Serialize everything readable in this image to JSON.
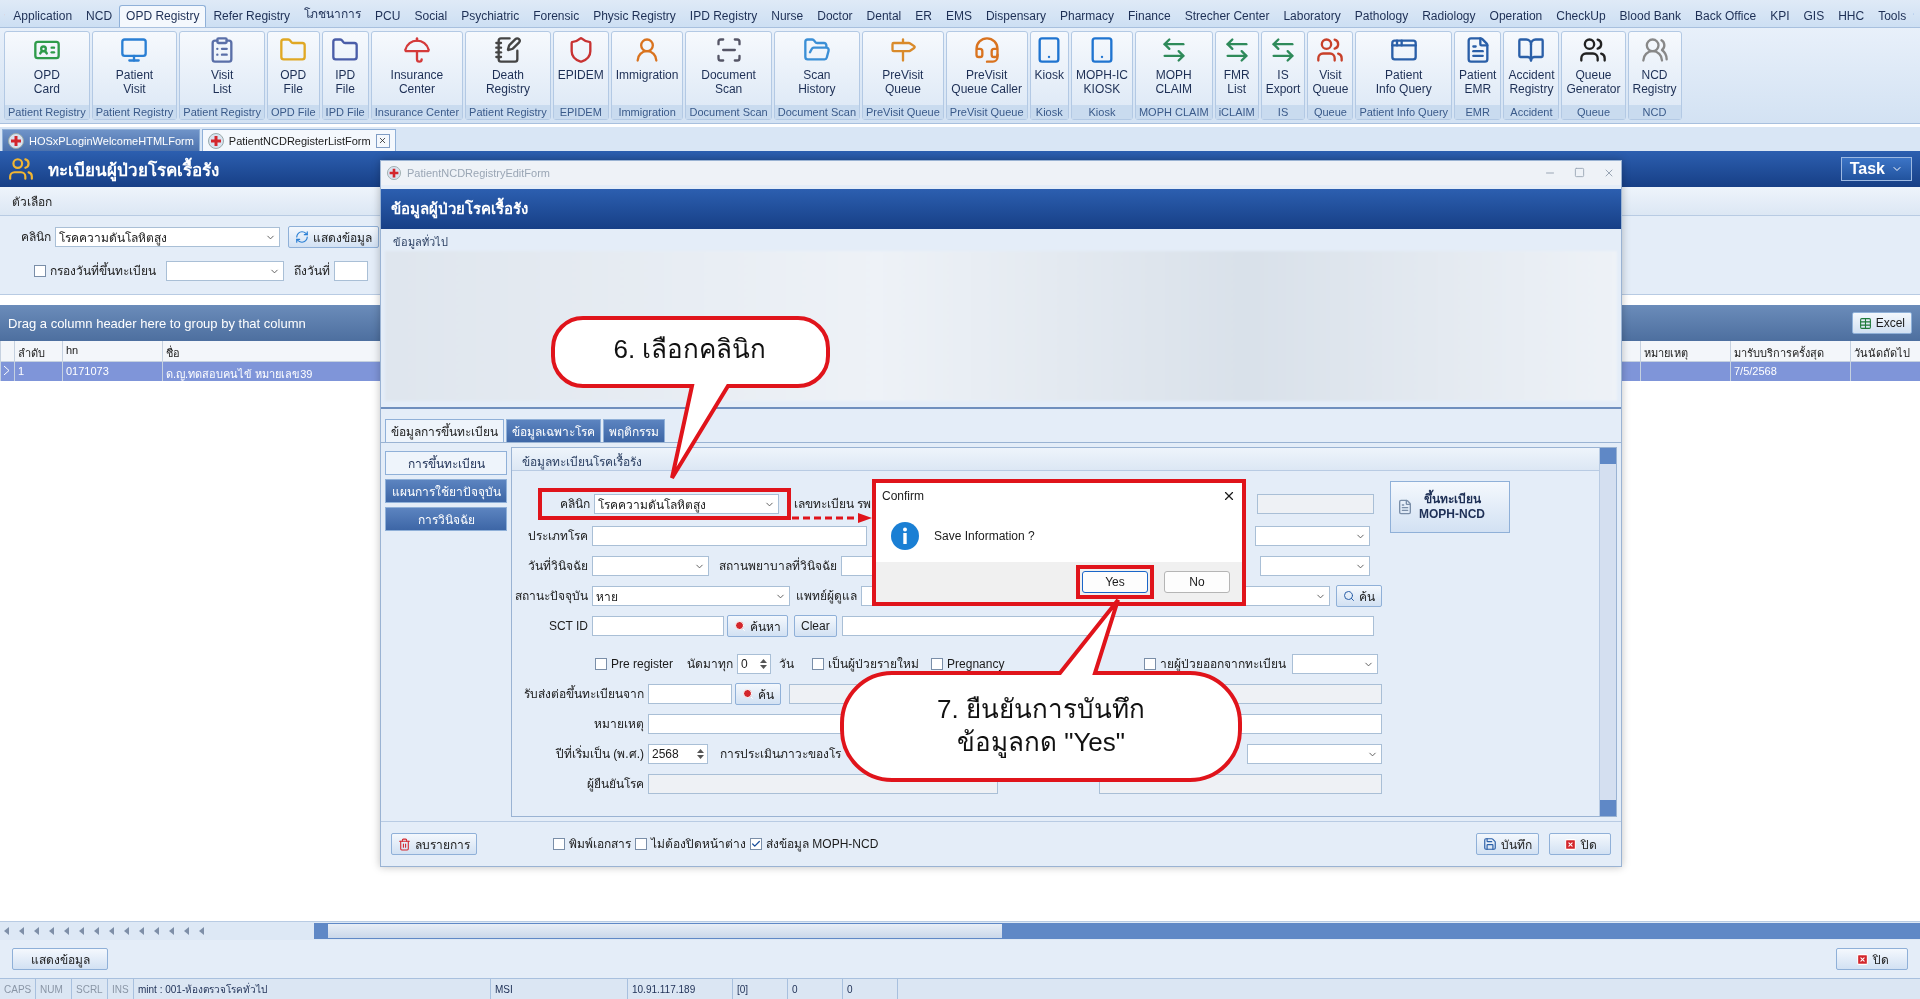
{
  "menu_tabs": [
    {
      "label": "Application",
      "selected": false
    },
    {
      "label": "NCD",
      "selected": false
    },
    {
      "label": "OPD Registry",
      "selected": true
    },
    {
      "label": "Refer Registry",
      "selected": false
    },
    {
      "label": "โภชนาการ",
      "selected": false
    },
    {
      "label": "PCU",
      "selected": false
    },
    {
      "label": "Social",
      "selected": false
    },
    {
      "label": "Psychiatric",
      "selected": false
    },
    {
      "label": "Forensic",
      "selected": false
    },
    {
      "label": "Physic Registry",
      "selected": false
    },
    {
      "label": "IPD Registry",
      "selected": false
    },
    {
      "label": "Nurse",
      "selected": false
    },
    {
      "label": "Doctor",
      "selected": false
    },
    {
      "label": "Dental",
      "selected": false
    },
    {
      "label": "ER",
      "selected": false
    },
    {
      "label": "EMS",
      "selected": false
    },
    {
      "label": "Dispensary",
      "selected": false
    },
    {
      "label": "Pharmacy",
      "selected": false
    },
    {
      "label": "Finance",
      "selected": false
    },
    {
      "label": "Strecher Center",
      "selected": false
    },
    {
      "label": "Laboratory",
      "selected": false
    },
    {
      "label": "Pathology",
      "selected": false
    },
    {
      "label": "Radiology",
      "selected": false
    },
    {
      "label": "Operation",
      "selected": false
    },
    {
      "label": "CheckUp",
      "selected": false
    },
    {
      "label": "Blood Bank",
      "selected": false
    },
    {
      "label": "Back Office",
      "selected": false
    },
    {
      "label": "KPI",
      "selected": false
    },
    {
      "label": "GIS",
      "selected": false
    },
    {
      "label": "HHC",
      "selected": false
    },
    {
      "label": "Tools",
      "selected": false
    }
  ],
  "ribbon": [
    {
      "lines": [
        "OPD",
        "Card"
      ],
      "group": "Patient Registry"
    },
    {
      "lines": [
        "Patient",
        "Visit"
      ],
      "group": "Patient Registry"
    },
    {
      "lines": [
        "Visit",
        "List"
      ],
      "group": "Patient Registry"
    },
    {
      "lines": [
        "OPD",
        "File"
      ],
      "group": "OPD File"
    },
    {
      "lines": [
        "IPD",
        "File"
      ],
      "group": "IPD File"
    },
    {
      "lines": [
        "Insurance",
        "Center"
      ],
      "group": "Insurance Center"
    },
    {
      "lines": [
        "Death",
        "Registry"
      ],
      "group": "Patient Registry"
    },
    {
      "lines": [
        "EPIDEM"
      ],
      "group": "EPIDEM"
    },
    {
      "lines": [
        "Immigration"
      ],
      "group": "Immigration"
    },
    {
      "lines": [
        "Document",
        "Scan"
      ],
      "group": "Document Scan"
    },
    {
      "lines": [
        "Scan",
        "History"
      ],
      "group": "Document Scan"
    },
    {
      "lines": [
        "PreVisit",
        "Queue"
      ],
      "group": "PreVisit Queue"
    },
    {
      "lines": [
        "PreVisit",
        "Queue Caller"
      ],
      "group": "PreVisit Queue"
    },
    {
      "lines": [
        "Kiosk"
      ],
      "group": "Kiosk"
    },
    {
      "lines": [
        "MOPH-IC",
        "KIOSK"
      ],
      "group": "Kiosk"
    },
    {
      "lines": [
        "MOPH",
        "CLAIM"
      ],
      "group": "MOPH CLAIM"
    },
    {
      "lines": [
        "FMR",
        "List"
      ],
      "group": "iCLAIM"
    },
    {
      "lines": [
        "IS",
        "Export"
      ],
      "group": "IS"
    },
    {
      "lines": [
        "Visit",
        "Queue"
      ],
      "group": "Queue"
    },
    {
      "lines": [
        "Patient",
        "Info Query"
      ],
      "group": "Patient Info Query"
    },
    {
      "lines": [
        "Patient",
        "EMR"
      ],
      "group": "EMR"
    },
    {
      "lines": [
        "Accident",
        "Registry"
      ],
      "group": "Accident"
    },
    {
      "lines": [
        "Queue",
        "Generator"
      ],
      "group": "Queue"
    },
    {
      "lines": [
        "NCD",
        "Registry"
      ],
      "group": "NCD"
    }
  ],
  "doc_tabs": [
    {
      "label": "HOSxPLoginWelcomeHTMLForm",
      "selected": false
    },
    {
      "label": "PatientNCDRegisterListForm",
      "selected": true
    }
  ],
  "list_form": {
    "title": "ทะเบียนผู้ป่วยโรคเรื้อรัง",
    "task_button": "Task",
    "options_caption": "ตัวเลือก",
    "clinic_label": "คลินิก",
    "clinic_value": "โรคความดันโลหิตสูง",
    "show_button": "แสดงข้อมูล",
    "date_filter": {
      "label": "กรองวันที่ขึ้นทะเบียน",
      "checked": false
    },
    "to_date_label": "ถึงวันที่",
    "group_hint": "Drag a column header here to group by that column",
    "excel_button": "Excel",
    "columns": [
      "ลำดับ",
      "hn",
      "ชื่อ",
      "หมายเหตุ",
      "มารับบริการครั้งสุด",
      "วันนัดถัดไป"
    ],
    "rows": [
      {
        "cells": [
          "1",
          "0171073",
          "ด.ญ.ทดสอบคนไข้ หมายเลข39",
          "",
          "7/5/2568",
          ""
        ],
        "selected": true
      }
    ],
    "bottom_show_button": "แสดงข้อมูล",
    "close_button": "ปิด"
  },
  "status_bar": {
    "keys": [
      "CAPS",
      "NUM",
      "SCRL",
      "INS"
    ],
    "user": "mint : 001-ห้องตรวจโรคทั่วไป",
    "machine": "MSI",
    "ip": "10.91.117.189",
    "count": "[0]",
    "field_5": "0",
    "field_6": "0"
  },
  "edit_form": {
    "title": "PatientNCDRegistryEditForm",
    "header": "ข้อมูลผู้ป่วยโรคเรื้อรัง",
    "general_caption": "ข้อมูลทั่วไป",
    "tabs": [
      {
        "label": "ข้อมูลการขึ้นทะเบียน",
        "selected": true
      },
      {
        "label": "ข้อมูลเฉพาะโรค",
        "selected": false
      },
      {
        "label": "พฤติกรรม",
        "selected": false
      }
    ],
    "side_tabs": [
      {
        "label": "การขึ้นทะเบียน",
        "selected": true
      },
      {
        "label": "แผนการใช้ยาปัจจุบัน",
        "selected": false
      },
      {
        "label": "การวินิจฉัย",
        "selected": false
      }
    ],
    "group_title": "ข้อมูลทะเบียนโรคเรื้อรัง",
    "clinic": {
      "label": "คลินิก",
      "value": "โรคความดันโลหิตสูง"
    },
    "hospital_no_label": "เลขทะเบียน รพ",
    "register_button": [
      "ขึ้นทะเบียน",
      "MOPH-NCD"
    ],
    "disease_type_label": "ประเภทโรค",
    "diagnosis_date_label": "วันที่วินิจฉัย",
    "diagnosis_place_label": "สถานพยาบาลที่วินิจฉัย",
    "status": {
      "label": "สถานะปัจจุบัน",
      "value": "หาย"
    },
    "doctor_label": "แพทย์ผู้ดูแล",
    "doctor_search_button": "ค้น",
    "sct_label": "SCT ID",
    "sct_search_button": "ค้นหา",
    "clear_button": "Clear",
    "pre_register": {
      "label": "Pre register",
      "checked": false
    },
    "appoint_label": "นัดมาทุก",
    "appoint_value": "0",
    "days_label": "วัน",
    "new_patient": {
      "label": "เป็นผู้ป่วยรายใหม่",
      "checked": false
    },
    "pregnancy": {
      "label": "Pregnancy",
      "checked": false
    },
    "discharge": {
      "label": "ายผู้ป่วยออกจากทะเบียน",
      "checked": false
    },
    "transfer_label": "รับส่งต่อขึ้นทะเบียนจาก",
    "transfer_search_button": "ค้น",
    "note_label": "หมายเหตุ",
    "start_year": {
      "label": "ปีที่เริ่มเป็น (พ.ศ.)",
      "value": "2568"
    },
    "assessment_label": "การประเมินภาวะของโร",
    "confirmer_label": "ผู้ยืนยันโรค",
    "delete_button": "ลบรายการ",
    "options": [
      {
        "label": "พิมพ์เอกสาร",
        "checked": false
      },
      {
        "label": "ไม่ต้องปิดหน้าต่าง",
        "checked": false
      },
      {
        "label": "ส่งข้อมูล MOPH-NCD",
        "checked": true
      }
    ],
    "save_button": "บันทึก",
    "close_button": "ปิด"
  },
  "confirm": {
    "title": "Confirm",
    "message": "Save Information ?",
    "yes": "Yes",
    "no": "No"
  },
  "callouts": [
    {
      "lines": [
        "6. เลือกคลินิก"
      ]
    },
    {
      "lines": [
        "7. ยืนยันการบันทึก",
        "ข้อมูลกด \"Yes\""
      ]
    }
  ]
}
